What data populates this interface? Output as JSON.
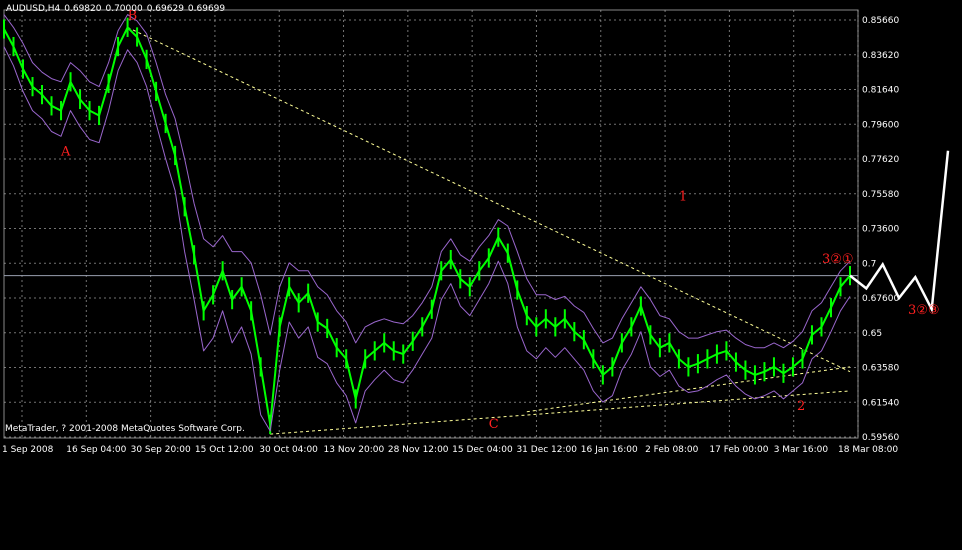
{
  "header": {
    "symbol": "AUDUSD,H4",
    "open": "0.69820",
    "high": "0.70000",
    "low": "0.69629",
    "close": "0.69699"
  },
  "copyright": "MetaTrader, ? 2001-2008 MetaQuotes Software Corp.",
  "colors": {
    "background": "#000000",
    "grid": "#c0c0c0",
    "price": "#00ff00",
    "bands": "#9966cc",
    "trendline": "#ffff99",
    "wave_labels": "#ff2020",
    "projection": "#ffffff"
  },
  "chart_data": {
    "type": "line",
    "title": "",
    "y_ticks": [
      "0.85660",
      "0.83620",
      "0.81640",
      "0.79600",
      "0.77620",
      "0.75580",
      "0.73600",
      "0.7",
      "0.67600",
      "0.65",
      "0.63580",
      "0.61540",
      "0.59560"
    ],
    "x_ticks": [
      "1 Sep 2008",
      "16 Sep 04:00",
      "30 Sep 20:00",
      "15 Oct 12:00",
      "30 Oct 04:00",
      "13 Nov 20:00",
      "28 Nov 12:00",
      "15 Dec 04:00",
      "31 Dec 12:00",
      "16 Jan 16:00",
      "2 Feb 08:00",
      "17 Feb 00:00",
      "3 Mar 16:00",
      "18 Mar 08:00"
    ],
    "ylim": [
      0.5956,
      0.8566
    ],
    "grid": true,
    "current_price": 0.697,
    "series": [
      {
        "role": "price",
        "values": [
          0.851,
          0.84,
          0.826,
          0.815,
          0.81,
          0.803,
          0.8,
          0.818,
          0.807,
          0.8,
          0.797,
          0.817,
          0.84,
          0.852,
          0.846,
          0.832,
          0.812,
          0.792,
          0.772,
          0.74,
          0.71,
          0.675,
          0.685,
          0.7,
          0.682,
          0.69,
          0.675,
          0.64,
          0.604,
          0.665,
          0.69,
          0.68,
          0.686,
          0.668,
          0.664,
          0.652,
          0.645,
          0.62,
          0.645,
          0.65,
          0.655,
          0.65,
          0.648,
          0.656,
          0.665,
          0.676,
          0.7,
          0.707,
          0.695,
          0.69,
          0.7,
          0.708,
          0.721,
          0.711,
          0.688,
          0.672,
          0.665,
          0.67,
          0.665,
          0.67,
          0.662,
          0.657,
          0.645,
          0.635,
          0.64,
          0.655,
          0.665,
          0.678,
          0.66,
          0.652,
          0.655,
          0.645,
          0.64,
          0.642,
          0.645,
          0.648,
          0.65,
          0.643,
          0.638,
          0.635,
          0.637,
          0.64,
          0.636,
          0.64,
          0.645,
          0.66,
          0.665,
          0.677,
          0.69,
          0.697
        ]
      },
      {
        "role": "upper-band",
        "values": [
          0.86,
          0.852,
          0.842,
          0.83,
          0.824,
          0.82,
          0.818,
          0.83,
          0.825,
          0.818,
          0.815,
          0.83,
          0.85,
          0.86,
          0.856,
          0.848,
          0.83,
          0.81,
          0.795,
          0.77,
          0.742,
          0.72,
          0.715,
          0.722,
          0.712,
          0.712,
          0.705,
          0.685,
          0.66,
          0.69,
          0.705,
          0.7,
          0.7,
          0.69,
          0.685,
          0.675,
          0.668,
          0.655,
          0.665,
          0.668,
          0.67,
          0.668,
          0.667,
          0.672,
          0.68,
          0.69,
          0.712,
          0.72,
          0.71,
          0.706,
          0.715,
          0.722,
          0.732,
          0.728,
          0.712,
          0.695,
          0.685,
          0.685,
          0.682,
          0.684,
          0.678,
          0.674,
          0.664,
          0.655,
          0.658,
          0.67,
          0.68,
          0.69,
          0.682,
          0.672,
          0.67,
          0.662,
          0.658,
          0.658,
          0.66,
          0.662,
          0.663,
          0.658,
          0.654,
          0.652,
          0.652,
          0.655,
          0.652,
          0.656,
          0.662,
          0.675,
          0.68,
          0.69,
          0.7,
          0.706
        ]
      },
      {
        "role": "lower-band",
        "values": [
          0.84,
          0.828,
          0.812,
          0.8,
          0.795,
          0.787,
          0.784,
          0.8,
          0.79,
          0.782,
          0.78,
          0.8,
          0.825,
          0.838,
          0.83,
          0.815,
          0.792,
          0.77,
          0.75,
          0.712,
          0.682,
          0.65,
          0.658,
          0.675,
          0.655,
          0.665,
          0.648,
          0.61,
          0.6,
          0.638,
          0.668,
          0.658,
          0.665,
          0.646,
          0.642,
          0.63,
          0.622,
          0.605,
          0.625,
          0.632,
          0.638,
          0.632,
          0.63,
          0.638,
          0.648,
          0.658,
          0.682,
          0.692,
          0.678,
          0.672,
          0.682,
          0.692,
          0.706,
          0.692,
          0.665,
          0.65,
          0.645,
          0.652,
          0.646,
          0.652,
          0.645,
          0.638,
          0.625,
          0.618,
          0.622,
          0.638,
          0.648,
          0.662,
          0.64,
          0.634,
          0.638,
          0.628,
          0.624,
          0.625,
          0.628,
          0.632,
          0.635,
          0.628,
          0.623,
          0.62,
          0.622,
          0.625,
          0.62,
          0.625,
          0.63,
          0.645,
          0.65,
          0.662,
          0.675,
          0.684
        ]
      }
    ],
    "trendlines": [
      {
        "role": "upper-trendline",
        "from": [
          13,
          0.852
        ],
        "to": [
          89,
          0.637
        ]
      },
      {
        "role": "lower-trendline-1",
        "from": [
          28,
          0.598
        ],
        "to": [
          89,
          0.625
        ]
      },
      {
        "role": "lower-trendline-2",
        "from": [
          55,
          0.612
        ],
        "to": [
          89,
          0.64
        ]
      }
    ],
    "projection": {
      "values": [
        0.697,
        0.689,
        0.704,
        0.683,
        0.696,
        0.676,
        0.775
      ]
    },
    "wave_labels": [
      {
        "text": "A",
        "index": 6,
        "y": 0.772
      },
      {
        "text": "B",
        "index": 13,
        "y": 0.857
      },
      {
        "text": "C",
        "index": 51,
        "y": 0.602
      },
      {
        "text": "1",
        "index": 71,
        "y": 0.744
      },
      {
        "text": "2",
        "index": 111,
        "y": 0.613
      },
      {
        "text": "3②①",
        "index": 116,
        "y": 0.705
      },
      {
        "text": "3②③",
        "index": 129,
        "y": 0.673
      }
    ]
  }
}
